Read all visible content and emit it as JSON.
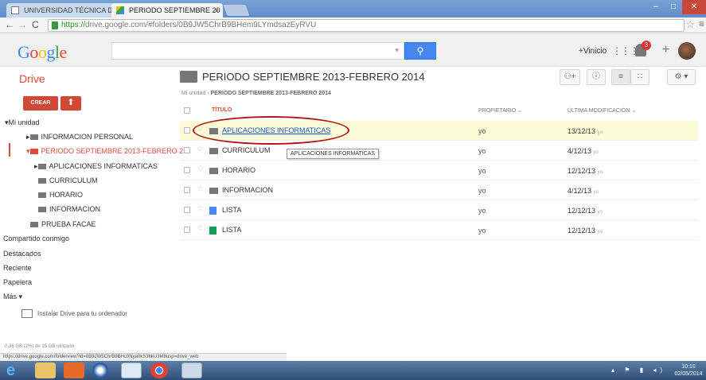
{
  "browser": {
    "tabs": [
      {
        "label": "UNIVERSIDAD TÉCNICA D",
        "active": false
      },
      {
        "label": "PERIODO SEPTIEMBRE 20",
        "active": true
      }
    ],
    "url_scheme": "https://",
    "url_rest": "drive.google.com/#folders/0B9JW5ChrB9BHem9LYmdsazEyRVU",
    "status_url": "https://drive.google.com/folderview?id=0B9JW5ChrB9BHc0Nya0kS3hkU3M8usp=drive_web"
  },
  "google_bar": {
    "logo": "Google",
    "user_label": "+Vinicio",
    "notification_count": "3"
  },
  "drive": {
    "app_title": "Drive",
    "folder_title": "PERIODO SEPTIEMBRE 2013-FEBRERO 2014",
    "breadcrumb_root": "Mi unidad",
    "breadcrumb_sep": "›",
    "breadcrumb_current": "PERIODO SEPTIEMBRE 2013-FEBRERO 2014",
    "create_label": "CREAR",
    "upload_label": "⬆"
  },
  "sidebar": {
    "my_drive": "▾Mi unidad",
    "items": [
      {
        "label": "INFORMACION PERSONAL",
        "prefix": "▸"
      },
      {
        "label": "PERIODO SEPTIEMBRE 2013-FEBRERO 2",
        "prefix": "▾"
      },
      {
        "label": "APLICACIONES INFORMATICAS",
        "prefix": "▸"
      },
      {
        "label": "CURRICULUM",
        "prefix": ""
      },
      {
        "label": "HORARIO",
        "prefix": ""
      },
      {
        "label": "INFORMACION",
        "prefix": ""
      },
      {
        "label": "PRUEBA FACAE",
        "prefix": ""
      }
    ],
    "links": [
      "Compartido conmigo",
      "Destacados",
      "Reciente",
      "Papelera",
      "Más ▾"
    ],
    "install_label": "Instalar Drive para tu ordenador",
    "quota": "0,36 GB (2%) de 15 GB utilizado"
  },
  "list": {
    "col_title": "TÍTULO",
    "col_owner": "PROPIETARIO",
    "col_modified": "ÚLTIMA MODIFICACIÓN",
    "rows": [
      {
        "name": "APLICACIONES INFORMATICAS",
        "type": "folder",
        "owner": "yo",
        "date": "13/12/13",
        "by": "yo"
      },
      {
        "name": "CURRICULUM",
        "type": "folder",
        "owner": "yo",
        "date": "4/12/13",
        "by": "yo"
      },
      {
        "name": "HORARIO",
        "type": "folder",
        "owner": "yo",
        "date": "12/12/13",
        "by": "yo"
      },
      {
        "name": "INFORMACION",
        "type": "folder",
        "owner": "yo",
        "date": "4/12/13",
        "by": "yo"
      },
      {
        "name": "LISTA",
        "type": "doc",
        "owner": "yo",
        "date": "12/12/13",
        "by": "yo"
      },
      {
        "name": "LISTA",
        "type": "sheet",
        "owner": "yo",
        "date": "12/12/13",
        "by": "yo"
      }
    ],
    "tooltip": "APLICACIONES INFORMATICAS"
  },
  "taskbar": {
    "time": "10:18",
    "date": "02/05/2014"
  },
  "colors": {
    "drive_red": "#dd4b39",
    "search_blue": "#4787ed",
    "highlight_row": "#fdfbd7",
    "annotation": "#b01818"
  }
}
